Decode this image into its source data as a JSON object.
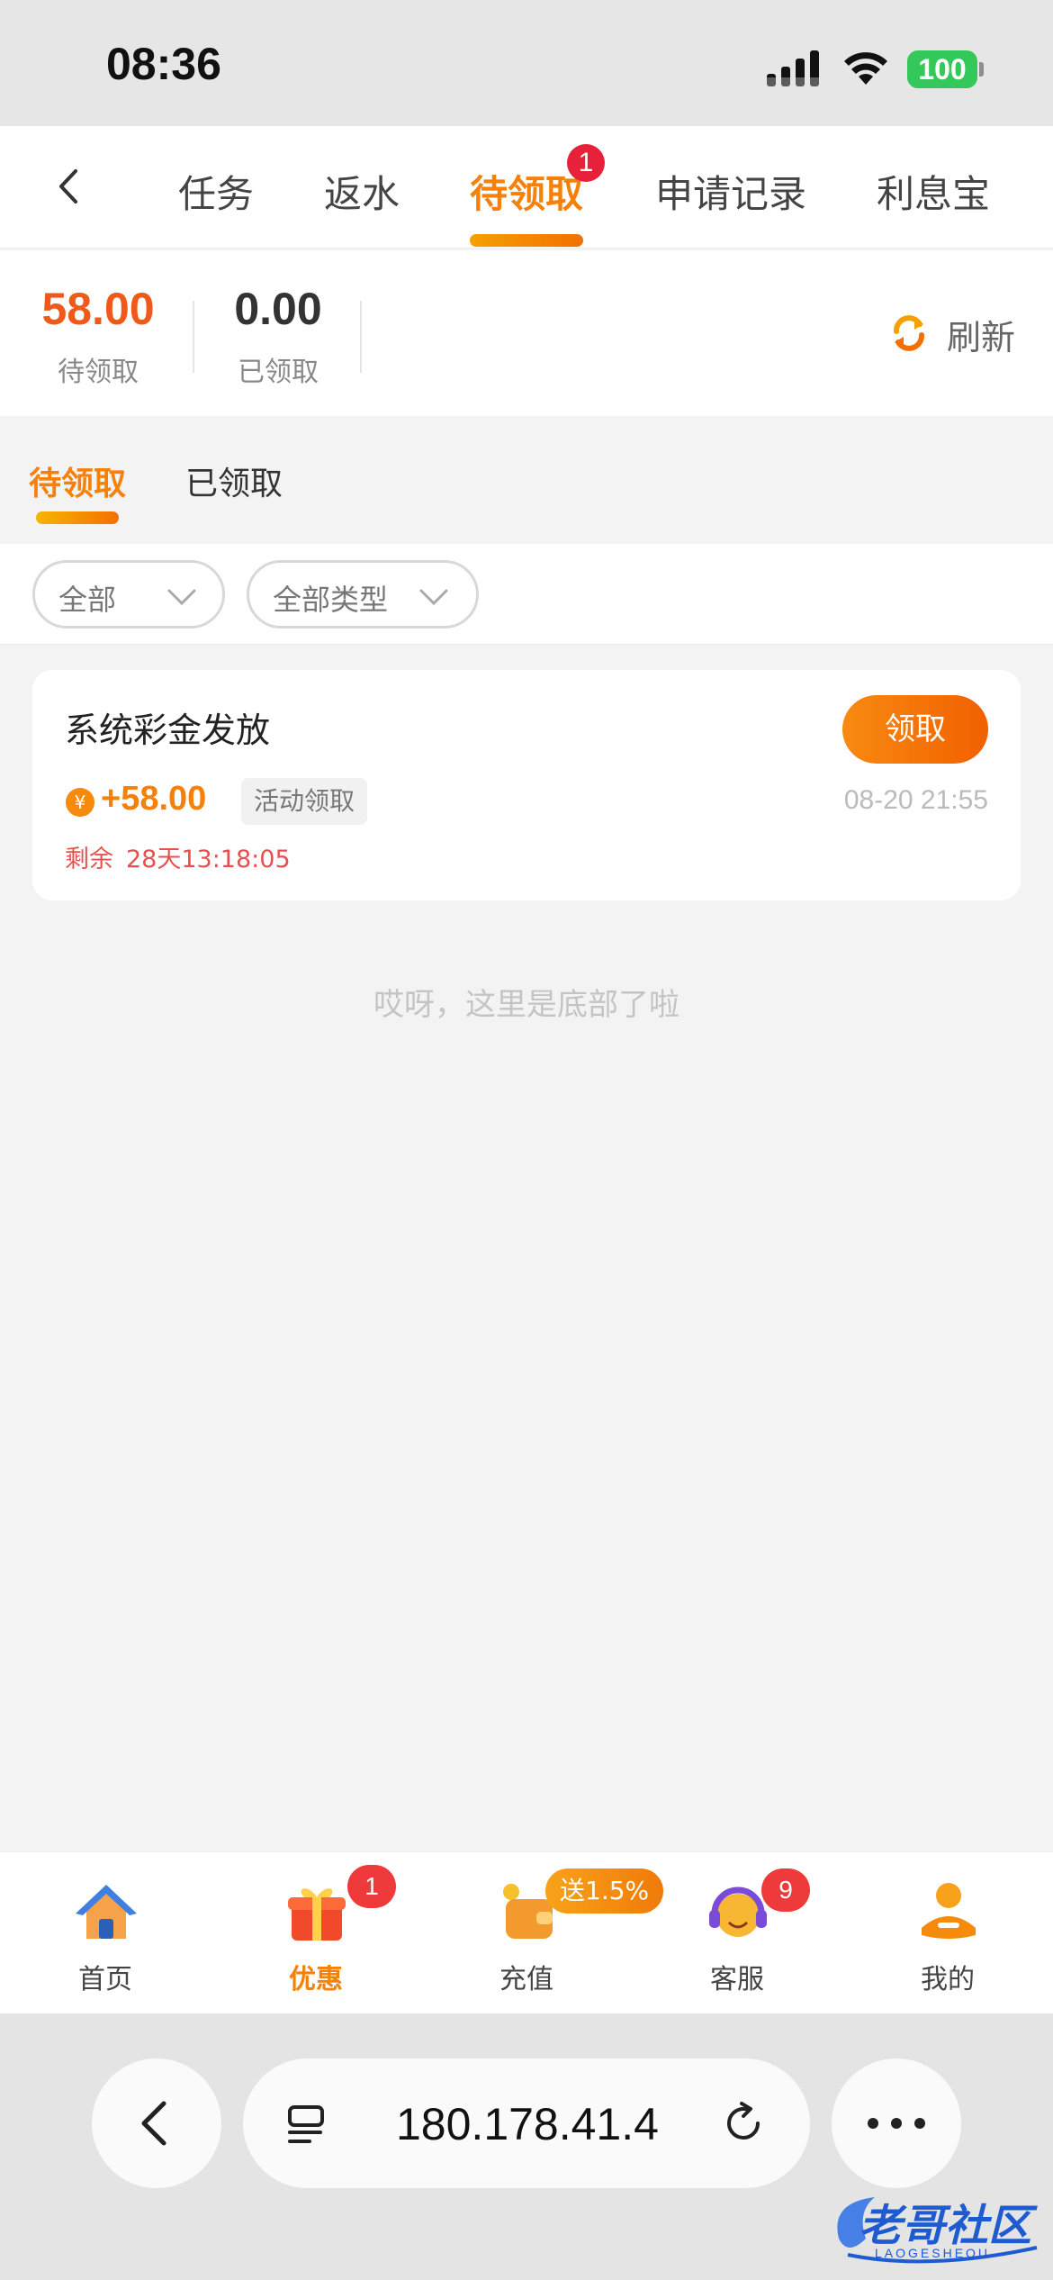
{
  "status_bar": {
    "time": "08:36",
    "battery": "100"
  },
  "top_nav": {
    "tabs": [
      {
        "label": "任务"
      },
      {
        "label": "返水"
      },
      {
        "label": "待领取",
        "badge": "1"
      },
      {
        "label": "申请记录"
      },
      {
        "label": "利息宝"
      }
    ],
    "active_tab": "待领取"
  },
  "summary": {
    "pending_value": "58.00",
    "pending_label": "待领取",
    "claimed_value": "0.00",
    "claimed_label": "已领取",
    "refresh_label": "刷新"
  },
  "sub_tabs": {
    "pending": "待领取",
    "claimed": "已领取"
  },
  "filters": {
    "scope": "全部",
    "type": "全部类型"
  },
  "reward": {
    "title": "系统彩金发放",
    "claim_label": "领取",
    "amount": "+58.00",
    "tag": "活动领取",
    "time": "08-20 21:55",
    "remain_label": "剩余",
    "remain_value": "28天13:18:05"
  },
  "end_hint": "哎呀，这里是底部了啦",
  "tab_bar": {
    "items": [
      {
        "label": "首页"
      },
      {
        "label": "优惠",
        "badge": "1"
      },
      {
        "label": "充值",
        "promo": "送1.5%"
      },
      {
        "label": "客服",
        "badge": "9"
      },
      {
        "label": "我的"
      }
    ],
    "active": "优惠"
  },
  "browser": {
    "url": "180.178.41.4"
  },
  "watermark": {
    "text": "老哥社区",
    "sub": "LAOGESHEQU"
  },
  "colors": {
    "accent": "#f5810b",
    "badge": "#e8213a",
    "claim_button": "#f26000"
  }
}
